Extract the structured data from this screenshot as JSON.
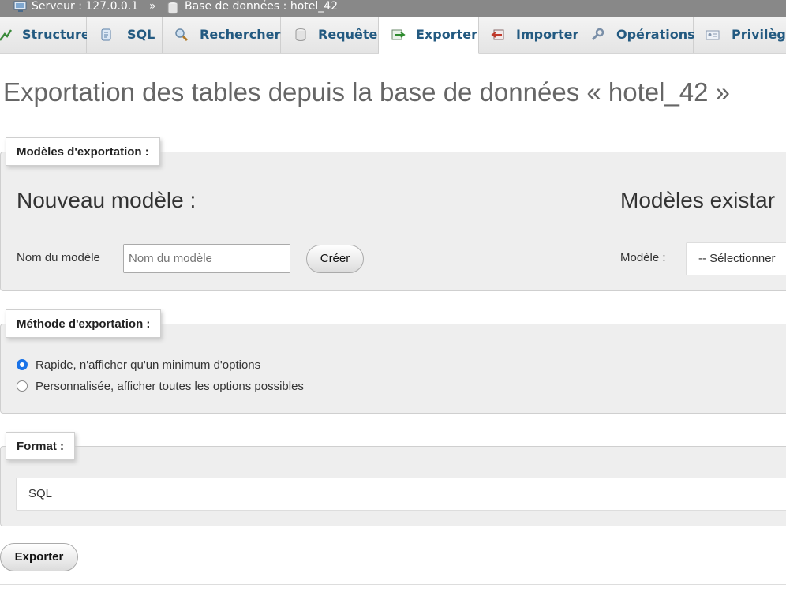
{
  "breadcrumb": {
    "server": "Serveur : 127.0.0.1",
    "separator": "»",
    "database": "Base de données : hotel_42"
  },
  "tabs": [
    {
      "label": "Structure",
      "icon": "structure-icon",
      "active": false
    },
    {
      "label": "SQL",
      "icon": "sql-icon",
      "active": false
    },
    {
      "label": "Rechercher",
      "icon": "search-icon",
      "active": false
    },
    {
      "label": "Requête",
      "icon": "query-icon",
      "active": false
    },
    {
      "label": "Exporter",
      "icon": "export-icon",
      "active": true
    },
    {
      "label": "Importer",
      "icon": "import-icon",
      "active": false
    },
    {
      "label": "Opérations",
      "icon": "wrench-icon",
      "active": false
    },
    {
      "label": "Privilège",
      "icon": "privileges-icon",
      "active": false
    }
  ],
  "page": {
    "title": "Exportation des tables depuis la base de données « hotel_42 »"
  },
  "templates": {
    "legend": "Modèles d'exportation :",
    "new_heading": "Nouveau modèle :",
    "existing_heading": "Modèles existar",
    "name_label": "Nom du modèle",
    "name_placeholder": "Nom du modèle",
    "create_button": "Créer",
    "model_label": "Modèle :",
    "model_select_value": "-- Sélectionner"
  },
  "method": {
    "legend": "Méthode d'exportation :",
    "options": [
      {
        "label": "Rapide, n'afficher qu'un minimum d'options",
        "checked": true
      },
      {
        "label": "Personnalisée, afficher toutes les options possibles",
        "checked": false
      }
    ]
  },
  "format": {
    "legend": "Format :",
    "selected": "SQL"
  },
  "actions": {
    "export_button": "Exporter"
  },
  "colors": {
    "tab_text": "#235a81",
    "radio_checked": "#1a73e8",
    "topbar": "#888888"
  }
}
